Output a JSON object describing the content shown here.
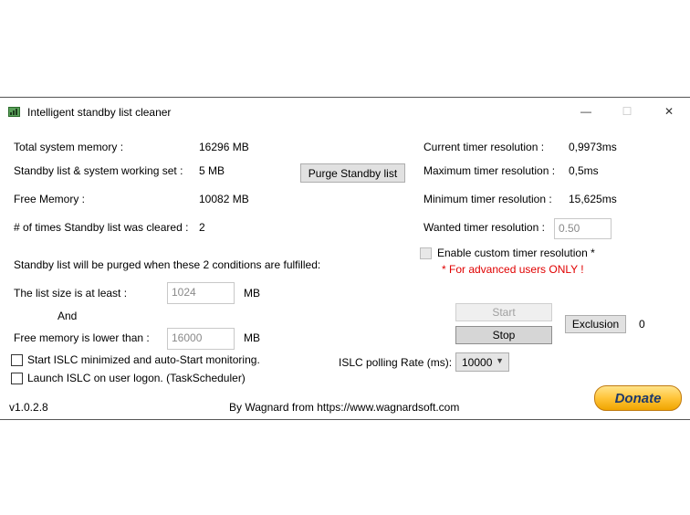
{
  "window": {
    "title": "Intelligent standby list cleaner",
    "controls": {
      "minimize": "—",
      "maximize": "☐",
      "close": "✕"
    }
  },
  "memory": {
    "total_label": "Total system memory :",
    "total_value": "16296 MB",
    "standby_label": "Standby list & system working set :",
    "standby_value": "5 MB",
    "free_label": "Free Memory :",
    "free_value": "10082 MB",
    "cleared_label": "# of times Standby list was cleared :",
    "cleared_value": "2",
    "purge_button": "Purge Standby list"
  },
  "timer": {
    "current_label": "Current timer resolution :",
    "current_value": "0,9973ms",
    "max_label": "Maximum timer resolution :",
    "max_value": "0,5ms",
    "min_label": "Minimum timer resolution :",
    "min_value": "15,625ms",
    "wanted_label": "Wanted timer resolution :",
    "wanted_value": "0.50",
    "custom_label": "Enable custom timer resolution *",
    "custom_checked": false,
    "advanced_note": "* For advanced users ONLY !"
  },
  "conditions": {
    "heading": "Standby list will be purged when these 2 conditions are fulfilled:",
    "list_size_label": "The list size is at least :",
    "list_size_value": "1024",
    "list_size_unit": "MB",
    "and_label": "And",
    "free_mem_label": "Free memory is lower than :",
    "free_mem_value": "16000",
    "free_mem_unit": "MB"
  },
  "options": {
    "start_minimized": "Start ISLC minimized and auto-Start monitoring.",
    "start_minimized_checked": false,
    "launch_logon": "Launch ISLC on user logon. (TaskScheduler)",
    "launch_logon_checked": false
  },
  "controls": {
    "start_button": "Start",
    "stop_button": "Stop",
    "exclusion_button": "Exclusion",
    "exclusion_count": "0",
    "polling_label": "ISLC polling Rate (ms):",
    "polling_value": "10000"
  },
  "footer": {
    "version": "v1.0.2.8",
    "credit": "By Wagnard from https://www.wagnardsoft.com",
    "donate_label": "Donate"
  },
  "colors": {
    "accent_red": "#e00000",
    "donate_gold": "#ffc439",
    "donate_text": "#1f3a6b"
  }
}
